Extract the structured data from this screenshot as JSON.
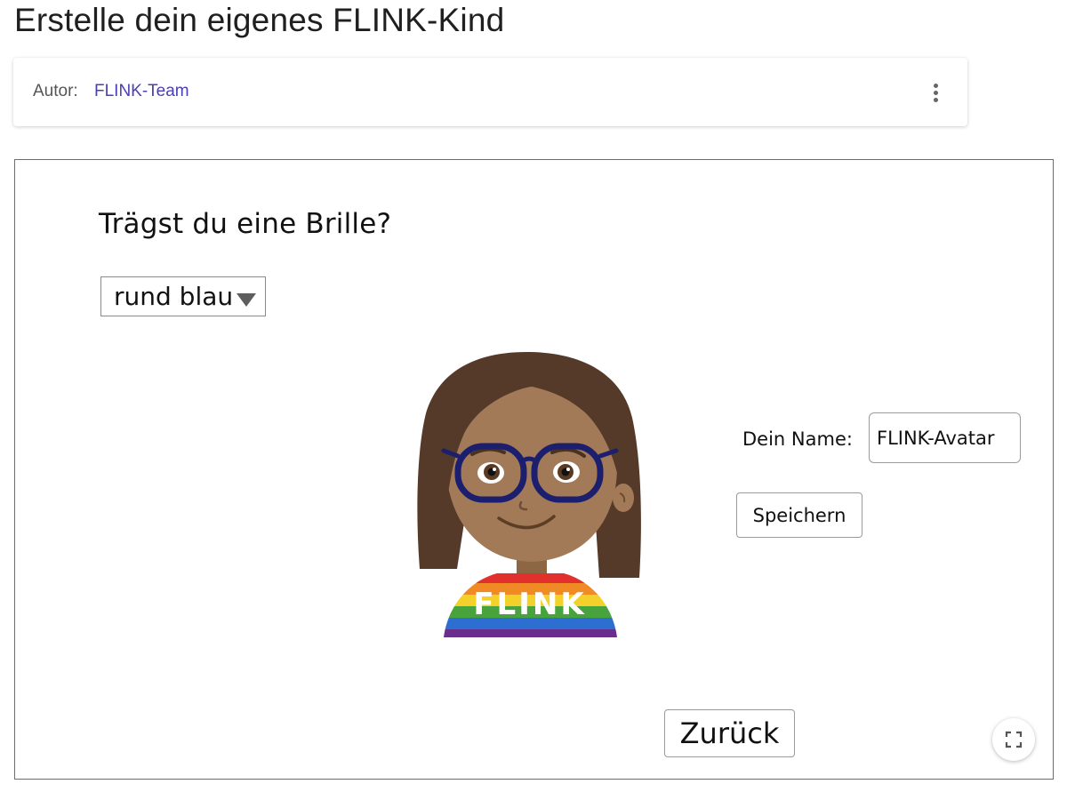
{
  "page": {
    "title": "Erstelle dein eigenes FLINK-Kind"
  },
  "author": {
    "label": "Autor:",
    "name": "FLINK-Team",
    "more_icon": "more-vert-icon"
  },
  "activity": {
    "question": "Trägst du eine Brille?",
    "glasses_select": {
      "value": "rund blau"
    },
    "avatar": {
      "shirt_text": "FLINK"
    },
    "name_label": "Dein Name:",
    "name_input_value": "FLINK-Avatar",
    "save_button": "Speichern",
    "back_button": "Zurück",
    "fullscreen_icon": "fullscreen-icon"
  },
  "colors": {
    "accent_link": "#4a3fb5",
    "hair": "#553a29",
    "skin": "#a27a57",
    "glasses": "#1c1f6e"
  }
}
